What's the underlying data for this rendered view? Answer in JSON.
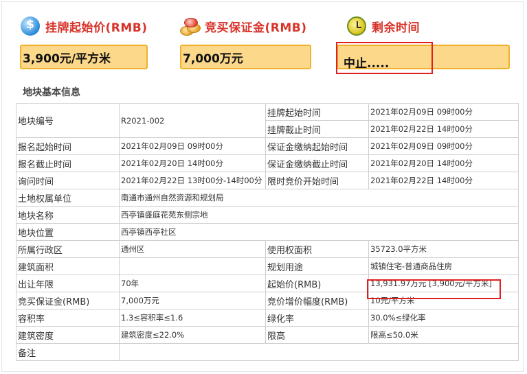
{
  "header": {
    "price_label": "挂牌起始价(RMB)",
    "deposit_label": "竞买保证金(RMB)",
    "time_label": "剩余时间",
    "price_value": "3,900元/平方米",
    "deposit_value": "7,000万元",
    "status_value": "中止....."
  },
  "section": {
    "title": "地块基本信息"
  },
  "table": {
    "row1": {
      "k1": "地块编号",
      "v1": "R2021-002",
      "k2a": "挂牌起始时间",
      "v2a": "2021年02月09日 09时00分",
      "k2b": "挂牌截止时间",
      "v2b": "2021年02月22日 14时00分"
    },
    "rows": [
      {
        "k1": "报名起始时间",
        "v1": "2021年02月09日 09时00分",
        "k2": "保证金缴纳起始时间",
        "v2": "2021年02月09日 09时00分"
      },
      {
        "k1": "报名截止时间",
        "v1": "2021年02月20日 14时00分",
        "k2": "保证金缴纳截止时间",
        "v2": "2021年02月20日 14时00分"
      },
      {
        "k1": "询问时间",
        "v1": "2021年02月22日 13时00分-14时00分",
        "k2": "限时竞价开始时间",
        "v2": "2021年02月22日 14时00分"
      }
    ],
    "full_rows": [
      {
        "k": "土地权属单位",
        "v": "南通市通州自然资源和规划局"
      },
      {
        "k": "地块名称",
        "v": "西亭镇盛庭花苑东侧宗地"
      },
      {
        "k": "地块位置",
        "v": "西亭镇西亭社区"
      }
    ],
    "rows2": [
      {
        "k1": "所属行政区",
        "v1": "通州区",
        "k2": "使用权面积",
        "v2": "35723.0平方米"
      },
      {
        "k1": "建筑面积",
        "v1": "",
        "k2": "规划用途",
        "v2": "城镇住宅-普通商品住房"
      },
      {
        "k1": "出让年限",
        "v1": "70年",
        "k2": "起始价(RMB)",
        "v2": "13,931.97万元 [3,900元/平方米]"
      },
      {
        "k1": "竞买保证金(RMB)",
        "v1": "7,000万元",
        "k2": "竞价增价幅度(RMB)",
        "v2": "10元/平方米"
      },
      {
        "k1": "容积率",
        "v1": "1.3≤容积率≤1.6",
        "k2": "绿化率",
        "v2": "30.0%≤绿化率"
      },
      {
        "k1": "建筑密度",
        "v1": "建筑密度≤22.0%",
        "k2": "限高",
        "v2": "限高≤50.0米"
      }
    ],
    "remark": {
      "k": "备注",
      "v": ""
    }
  }
}
